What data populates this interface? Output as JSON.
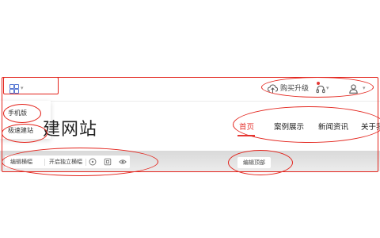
{
  "toolbar": {
    "grid_icon": "apps-grid-icon",
    "upgrade_label": "购买升级",
    "upgrade_icon": "cloud-cart-icon",
    "support_icon": "headset-icon",
    "user_icon": "user-icon",
    "accent_color": "#5b7bd5",
    "badge_color": "#e53935"
  },
  "dropdown": {
    "items": [
      {
        "label": "手机版"
      },
      {
        "label": "极速建站"
      }
    ]
  },
  "site": {
    "title_visible": "建网站"
  },
  "nav": {
    "items": [
      {
        "label": "首页",
        "active": true
      },
      {
        "label": "案例展示",
        "active": false
      },
      {
        "label": "新闻资讯",
        "active": false
      },
      {
        "label": "关于我",
        "active": false
      }
    ],
    "active_color": "#e53935"
  },
  "edit_bar": {
    "edit_label": "编辑横幅",
    "independent_label": "开启独立横幅",
    "icons": [
      "help-circle-icon",
      "info-square-icon",
      "eye-icon"
    ]
  },
  "header_edit": {
    "label": "编辑顶部"
  },
  "annotation_color": "#e3231b"
}
